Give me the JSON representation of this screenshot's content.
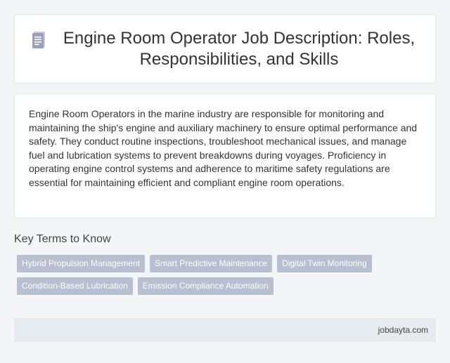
{
  "header": {
    "icon": "document-icon",
    "title": "Engine Room Operator Job Description: Roles, Responsibilities, and Skills"
  },
  "description": {
    "text": "Engine Room Operators in the marine industry are responsible for monitoring and maintaining the ship's engine and auxiliary machinery to ensure optimal performance and safety. They conduct routine inspections, troubleshoot mechanical issues, and manage fuel and lubrication systems to prevent breakdowns during voyages. Proficiency in operating engine control systems and adherence to maritime safety regulations are essential for maintaining efficient and compliant engine room operations."
  },
  "key_terms": {
    "heading": "Key Terms to Know",
    "rows": [
      [
        "Hybrid Propulsion Management",
        "Smart Predictive Maintenance",
        "Digital Twin Monitoring"
      ],
      [
        "Condition-Based Lubrication",
        "Emission Compliance Automation"
      ]
    ]
  },
  "footer": {
    "site": "jobdayta.com"
  },
  "colors": {
    "background": "#f3f5f7",
    "tag_bg": "#b8bfd0",
    "footer_bg": "#e5ebee",
    "icon": "#9aa0b8"
  }
}
